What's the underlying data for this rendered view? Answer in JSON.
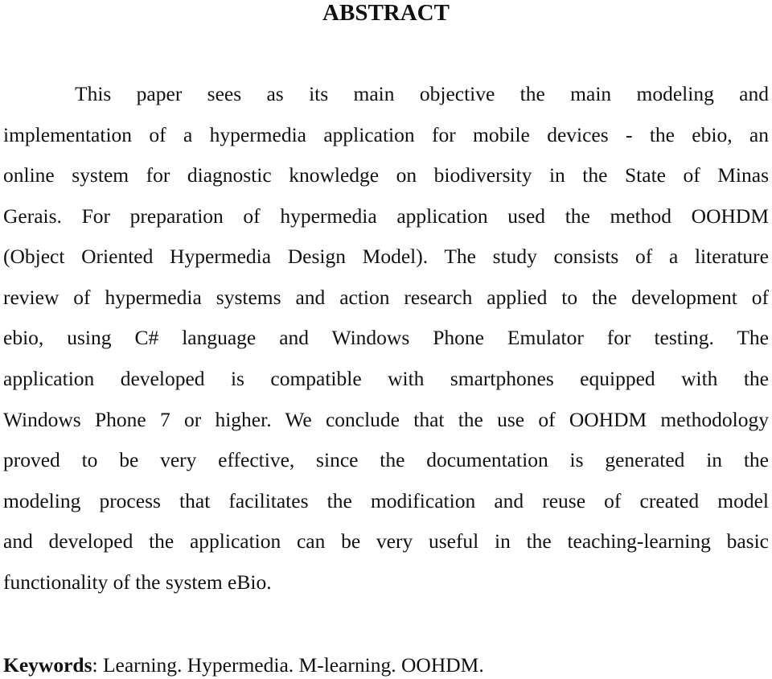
{
  "heading": "ABSTRACT",
  "abstract_lines": [
    "This paper sees as its main objective the main modeling and",
    "implementation of a hypermedia application for mobile devices - the ebio, an",
    "online system for diagnostic knowledge on biodiversity in the State of Minas",
    "Gerais. For preparation of hypermedia application used the method OOHDM",
    "(Object Oriented Hypermedia Design Model). The study consists of a literature",
    "review of hypermedia systems and action research applied to the development of",
    "ebio, using C# language and Windows Phone Emulator for testing. The",
    "application developed is compatible with smartphones equipped with the",
    "Windows Phone 7 or higher. We conclude that the use of OOHDM methodology",
    "proved to be very effective, since the documentation is generated in the",
    "modeling process that facilitates the modification and reuse of created model",
    "and developed the application can be very useful in the teaching-learning basic",
    "functionality of the system eBio."
  ],
  "keywords": {
    "label": "Keywords",
    "text": ": Learning. Hypermedia. M-learning. OOHDM."
  }
}
